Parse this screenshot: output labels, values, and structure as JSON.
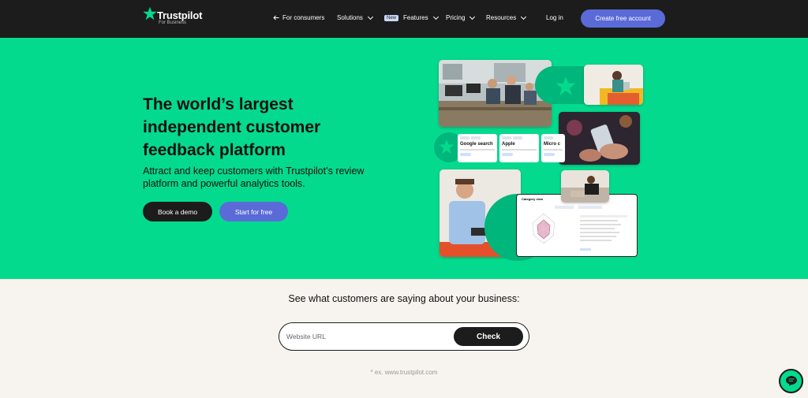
{
  "nav": {
    "logo_name": "Trustpilot",
    "logo_sub": "For Business",
    "for_consumers": "For consumers",
    "solutions": "Solutions",
    "new_badge": "New",
    "features": "Features",
    "pricing": "Pricing",
    "resources": "Resources",
    "login": "Log in",
    "cta": "Create free account"
  },
  "hero": {
    "headline": "The world’s largest independent customer feedback platform",
    "subline": "Attract and keep customers with Trustpilot’s review platform and powerful analytics tools.",
    "book_demo": "Book a demo",
    "start_free": "Start for free",
    "cards": [
      "Google search",
      "Apple",
      "Micro c"
    ],
    "dashboard_title": "Category view"
  },
  "check": {
    "title": "See what customers are saying about your business:",
    "placeholder": "Website URL",
    "button": "Check",
    "example": "* ex. www.trustpilot.com"
  },
  "colors": {
    "brand_green": "#04da8d",
    "nav_bg": "#1c1c1c",
    "accent_blue": "#5a6bd8"
  },
  "icons": [
    "trustpilot-star-icon",
    "arrow-left-icon",
    "chevron-down-icon",
    "chat-icon"
  ]
}
